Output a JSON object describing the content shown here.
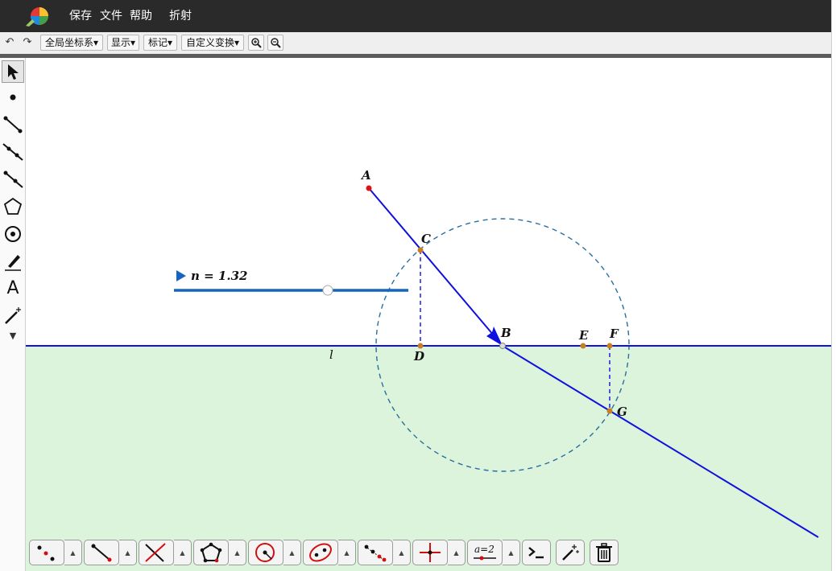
{
  "menu": {
    "save": "保存",
    "file": "文件",
    "help": "帮助",
    "title": "折射"
  },
  "toolbar": {
    "undo_icon": "undo-icon",
    "redo_icon": "redo-icon",
    "coord": "全局坐标系",
    "show": "显示",
    "mark": "标记",
    "transform": "自定义变换",
    "zoom_in_icon": "zoom-in-icon",
    "zoom_out_icon": "zoom-out-icon"
  },
  "slider": {
    "label": "n = 1.32",
    "value": 1.32
  },
  "points": {
    "A": "A",
    "B": "B",
    "C": "C",
    "D": "D",
    "E": "E",
    "F": "F",
    "G": "G"
  },
  "line_label": "l",
  "bottom_tools": {
    "expression_label": "a=2"
  },
  "colors": {
    "ray": "#1010e0",
    "circle": "#2a6f9e",
    "point_orange": "#c8801f",
    "point_red": "#e01010",
    "lower_medium": "#dcf3dc",
    "slider": "#1565c0"
  }
}
